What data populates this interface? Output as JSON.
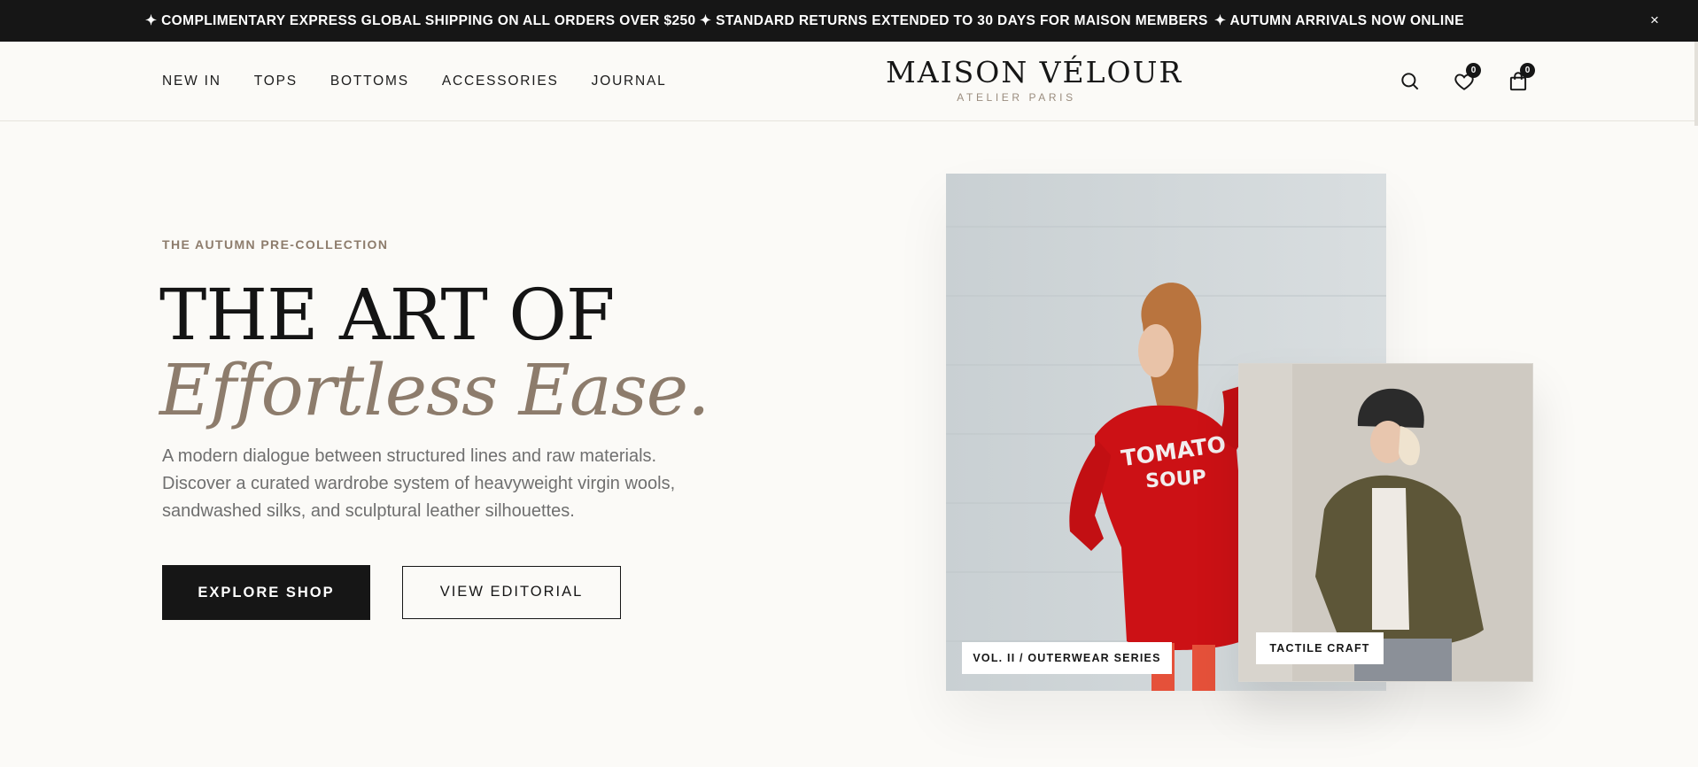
{
  "announcement": {
    "messages": [
      "✦ COMPLIMENTARY EXPRESS GLOBAL SHIPPING ON ALL ORDERS OVER $250",
      "✦ STANDARD RETURNS EXTENDED TO 30 DAYS FOR MAISON MEMBERS",
      "✦ AUTUMN ARRIVALS NOW ONLINE"
    ],
    "close_icon": "×"
  },
  "nav": {
    "items": [
      "NEW IN",
      "TOPS",
      "BOTTOMS",
      "ACCESSORIES",
      "JOURNAL"
    ]
  },
  "logo": {
    "brand": "MAISON VÉLOUR",
    "subtitle": "ATELIER PARIS"
  },
  "header_actions": {
    "icons": [
      "search-icon",
      "heart-icon",
      "shopping-bag-icon"
    ],
    "wishlist_count": "0",
    "cart_count": "0"
  },
  "hero": {
    "eyebrow": "THE AUTUMN PRE-COLLECTION",
    "headline": "THE ART OF",
    "headline_italic": "Effortless Ease.",
    "description": "A modern dialogue between structured lines and raw materials. Discover a curated wardrobe system of heavyweight virgin wools, sandwashed silks, and sculptural leather silhouettes.",
    "primary_cta": "EXPLORE SHOP",
    "secondary_cta": "VIEW EDITORIAL"
  },
  "gallery": {
    "main_image_caption": "VOL. II / OUTERWEAR SERIES",
    "main_image_shirt_text": "TOMATO SOUP",
    "secondary_image_caption": "TACTILE CRAFT"
  },
  "colors": {
    "accent": "#8d7c6c",
    "ink": "#161616",
    "background": "#fbfaf7"
  }
}
